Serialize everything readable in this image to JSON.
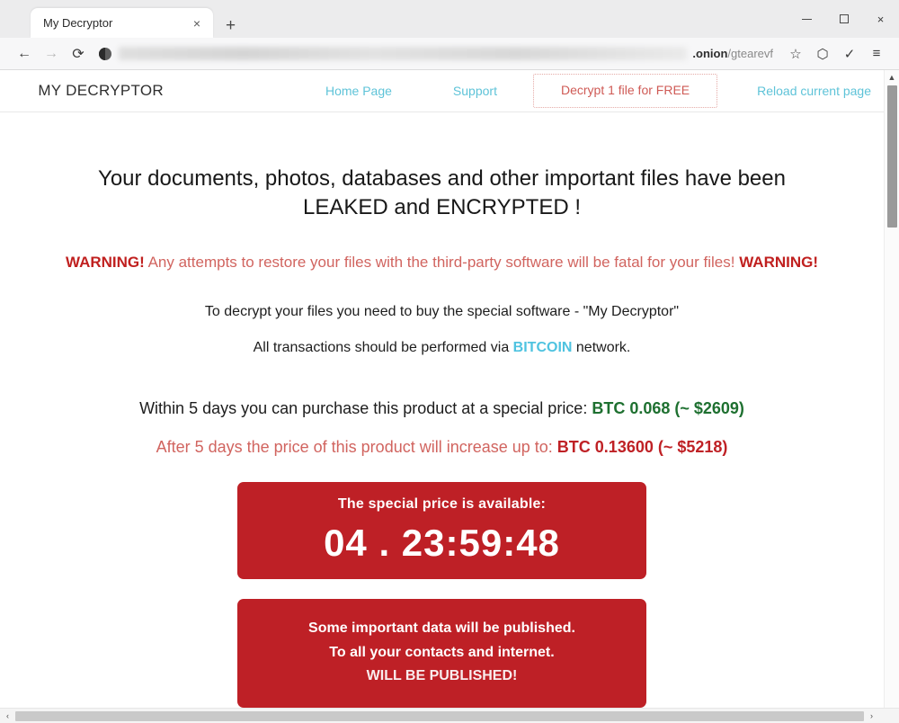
{
  "browser": {
    "tab": {
      "title": "My Decryptor",
      "close_label": "×"
    },
    "new_tab_label": "+",
    "window_controls": {
      "minimize": "",
      "maximize": "",
      "close": "×"
    },
    "toolbar": {
      "back": "←",
      "forward": "→",
      "reload": "⟳",
      "url_domain": ".onion",
      "url_path": "/gtearevf",
      "bookmark": "☆",
      "shield": "⬡",
      "tracker": "✓",
      "menu": "≡"
    }
  },
  "site": {
    "brand": "MY DECRYPTOR",
    "nav": {
      "home": "Home Page",
      "support": "Support",
      "decrypt_free": "Decrypt 1 file for FREE",
      "reload": "Reload current page"
    }
  },
  "main": {
    "headline_line1": "Your documents, photos, databases and other important files have been",
    "headline_line2": "LEAKED and ENCRYPTED !",
    "warning_prefix": "WARNING!",
    "warning_text": " Any attempts to restore your files with the third-party software will be fatal for your files! ",
    "warning_suffix": "WARNING!",
    "instruction": "To decrypt your files you need to buy the special software - \"My Decryptor\"",
    "transactions_prefix": "All transactions should be performed via ",
    "transactions_currency": "BITCOIN",
    "transactions_suffix": " network.",
    "special_price_text": "Within 5 days you can purchase this product at a special price: ",
    "special_price_value": "BTC 0.068 (~ $2609)",
    "increase_price_text": "After 5 days the price of this product will increase up to: ",
    "increase_price_value": "BTC 0.13600 (~ $5218)",
    "timer_panel": {
      "title": "The special price is available:",
      "countdown": "04 . 23:59:48"
    },
    "publish_panel": {
      "line1": "Some important data will be published.",
      "line2": "To all your contacts and internet.",
      "line3_clipped": "WILL BE PUBLISHED!"
    }
  },
  "scroll": {
    "up_arrow": "▲",
    "left_arrow": "‹",
    "right_arrow": "›"
  },
  "colors": {
    "panel_red": "#be2026",
    "warning_red": "#c0201f",
    "price_green": "#1e7030",
    "link_cyan": "#5ec3d8",
    "bitcoin_cyan": "#4fc3e0"
  }
}
